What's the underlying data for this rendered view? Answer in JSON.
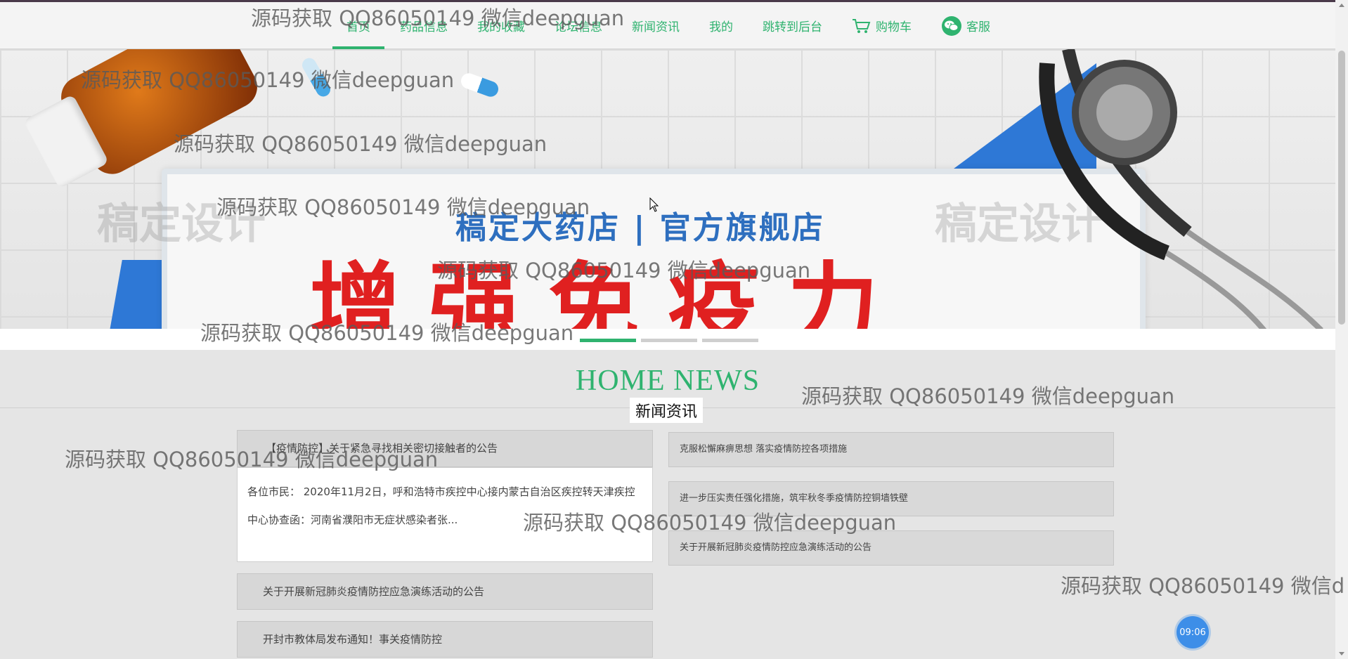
{
  "nav": {
    "items": [
      {
        "label": "首页",
        "active": true
      },
      {
        "label": "药品信息"
      },
      {
        "label": "我的收藏"
      },
      {
        "label": "论坛信息"
      },
      {
        "label": "新闻资讯"
      },
      {
        "label": "我的"
      },
      {
        "label": "跳转到后台"
      },
      {
        "label": "购物车",
        "icon": "cart-icon"
      },
      {
        "label": "客服",
        "icon": "wechat-icon"
      }
    ]
  },
  "banner": {
    "board_title": "稿定大药店 | 官方旗舰店",
    "board_big": "增强免疫力",
    "logo_watermark": "稿定设计",
    "slides_count": 3,
    "active_slide": 1
  },
  "news": {
    "title_en": "HOME NEWS",
    "title_cn": "新闻资讯",
    "featured": {
      "title": "【疫情防控】关于紧急寻找相关密切接触者的公告",
      "summary": "各位市民：  2020年11月2日，呼和浩特市疾控中心接内蒙古自治区疾控转天津疾控中心协查函：河南省濮阳市无症状感染者张..."
    },
    "left_list": [
      "关于开展新冠肺炎疫情防控应急演练活动的公告",
      "开封市教体局发布通知！事关疫情防控"
    ],
    "right_list": [
      "克服松懈麻痹思想 落实疫情防控各项措施",
      "进一步压实责任强化措施，筑牢秋冬季疫情防控铜墙铁壁",
      "关于开展新冠肺炎疫情防控应急演练活动的公告"
    ]
  },
  "clock": "09:06",
  "watermark": "源码获取 QQ86050149 微信deepguan",
  "watermark_cut": "源码获取 QQ86050149 微信d",
  "colors": {
    "accent": "#2fb36f",
    "banner_red": "#e02020",
    "banner_blue": "#2e78d6",
    "clock": "#3d8ee8"
  }
}
